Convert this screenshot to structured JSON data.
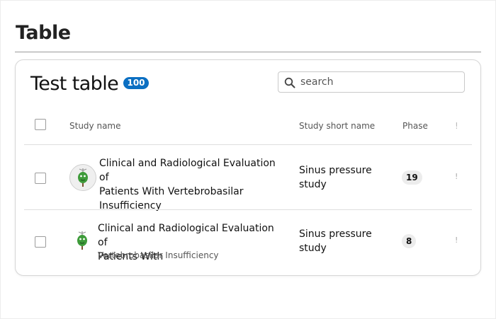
{
  "page": {
    "title": "Table"
  },
  "card": {
    "title": "Test table",
    "count": "100",
    "search": {
      "placeholder": "search",
      "value": ""
    }
  },
  "columns": {
    "study_name": "Study name",
    "short_name": "Study short name",
    "phase": "Phase",
    "more": "!"
  },
  "rows": [
    {
      "name_lines": [
        "Clinical and Radiological Evaluation of",
        "Patients With Vertebrobasilar",
        "Insufficiency"
      ],
      "short_lines": [
        "Sinus pressure",
        "study"
      ],
      "phase": "19",
      "more": "!",
      "avatar_icon": "tree-mascot-icon"
    },
    {
      "name_lines": [
        "Clinical and Radiological Evaluation of",
        "Patients With"
      ],
      "subtitle": "Vertebrobasilar Insufficiency",
      "short_lines": [
        "Sinus pressure",
        "study"
      ],
      "phase": "8",
      "more": "!",
      "avatar_icon": "tree-mascot-icon"
    }
  ],
  "colors": {
    "badge": "#0b6fc2",
    "pill": "#ececec",
    "mascot": "#3e9b3a"
  }
}
